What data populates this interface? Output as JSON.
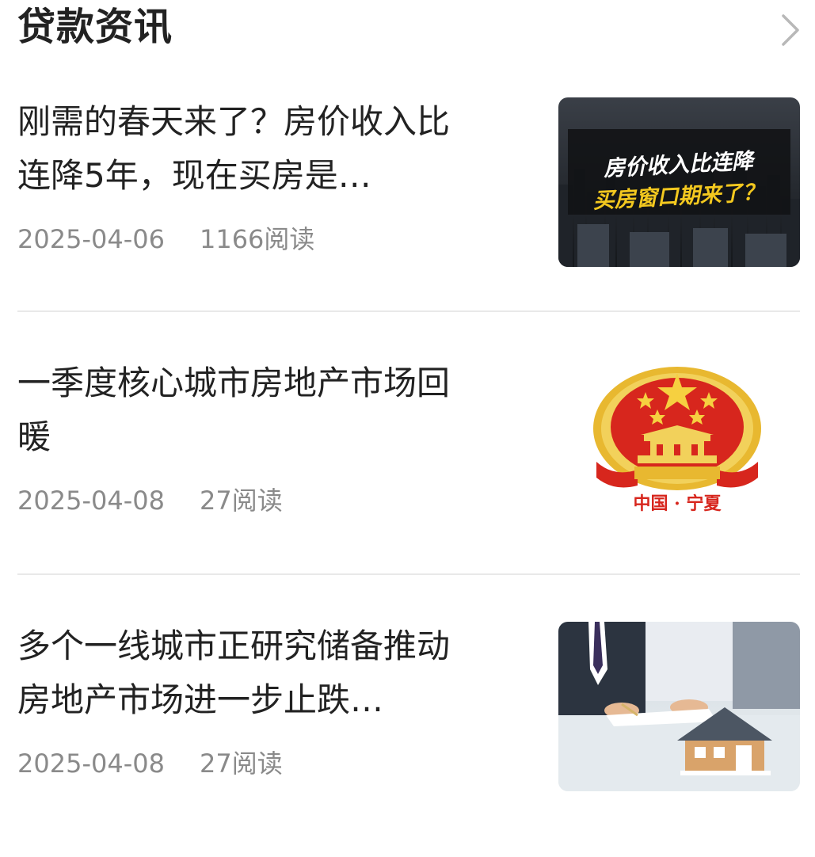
{
  "section": {
    "title": "贷款资讯",
    "more_icon": "chevron-right-icon"
  },
  "articles": [
    {
      "title": "刚需的春天来了？房价收入比连降5年，现在买房是…",
      "date": "2025-04-06",
      "reads": "1166阅读",
      "thumb": {
        "line1": "房价收入比连降",
        "line2": "买房窗口期来了？"
      }
    },
    {
      "title": "一季度核心城市房地产市场回暖",
      "date": "2025-04-08",
      "reads": "27阅读",
      "thumb": {
        "caption": "中国 · 宁夏"
      }
    },
    {
      "title": "多个一线城市正研究储备推动房地产市场进一步止跌…",
      "date": "2025-04-08",
      "reads": "27阅读"
    }
  ],
  "colors": {
    "title_text": "#222222",
    "meta_text": "#8a8a8a",
    "divider": "#e9e9e9",
    "emblem_red": "#d7261d",
    "emblem_gold": "#e8b830"
  }
}
